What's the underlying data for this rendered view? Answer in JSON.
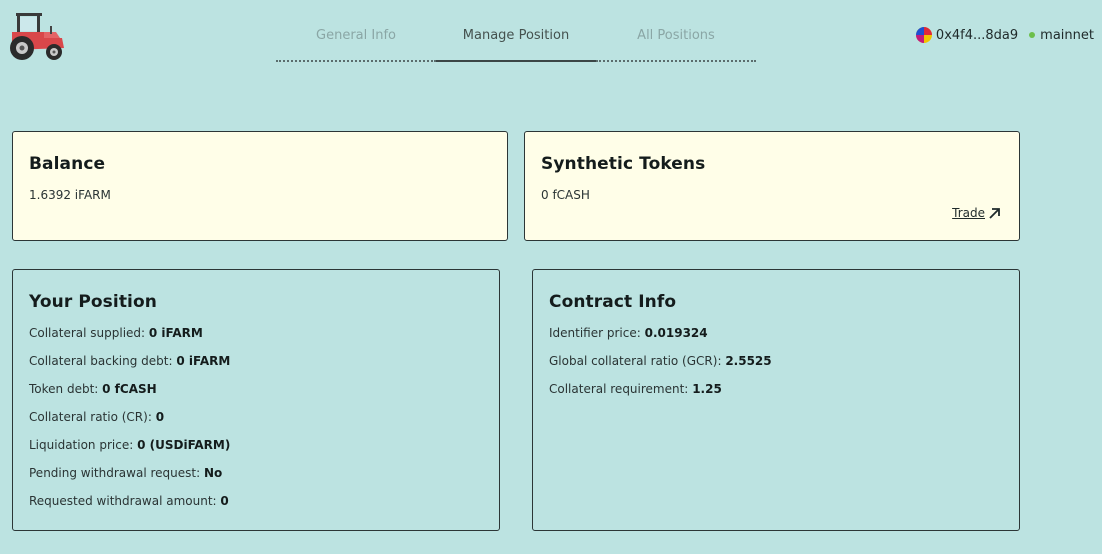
{
  "header": {
    "tabs": [
      {
        "label": "General Info"
      },
      {
        "label": "Manage Position"
      },
      {
        "label": "All Positions"
      }
    ],
    "account": {
      "address": "0x4f4...8da9",
      "network": "mainnet"
    }
  },
  "balance": {
    "title": "Balance",
    "value": "1.6392 iFARM"
  },
  "synthetic": {
    "title": "Synthetic Tokens",
    "value": "0 fCASH",
    "trade_label": "Trade"
  },
  "position": {
    "title": "Your Position",
    "rows": [
      {
        "label": "Collateral supplied:",
        "value": "0 iFARM"
      },
      {
        "label": "Collateral backing debt:",
        "value": "0 iFARM"
      },
      {
        "label": "Token debt:",
        "value": "0 fCASH"
      },
      {
        "label": "Collateral ratio (CR):",
        "value": "0"
      },
      {
        "label": "Liquidation price:",
        "value": "0 (USDiFARM)"
      },
      {
        "label": "Pending withdrawal request:",
        "value": "No"
      },
      {
        "label": "Requested withdrawal amount:",
        "value": "0"
      }
    ]
  },
  "contract": {
    "title": "Contract Info",
    "rows": [
      {
        "label": "Identifier price:",
        "value": "0.019324"
      },
      {
        "label": "Global collateral ratio (GCR):",
        "value": "2.5525"
      },
      {
        "label": "Collateral requirement:",
        "value": "1.25"
      }
    ]
  }
}
